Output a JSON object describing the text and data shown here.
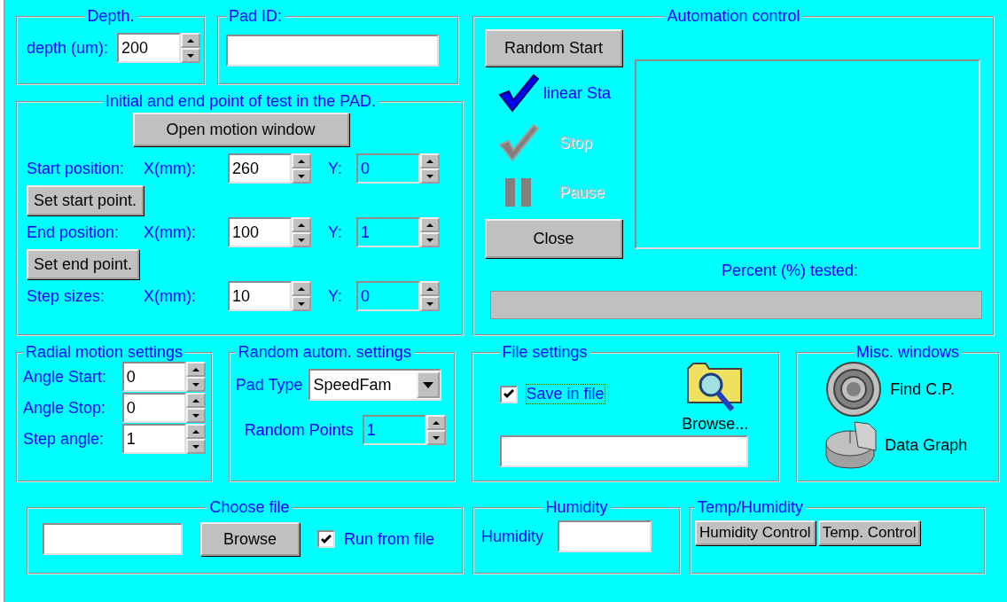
{
  "depth_group": {
    "title": "Depth.",
    "label": "depth (um):",
    "field": {
      "value": "200",
      "disabled": false
    }
  },
  "pad_id_group": {
    "title": "Pad ID:"
  },
  "test_points_group": {
    "title": "Initial and end point of test in the PAD.",
    "open_button": "Open motion window",
    "rows": [
      {
        "label": "Start position:",
        "x_label": "X(mm):",
        "x": {
          "value": "260",
          "disabled": false
        },
        "y_label": "Y:",
        "y": {
          "value": "0",
          "disabled": true
        },
        "button": "Set start point."
      },
      {
        "label": "End position:",
        "x_label": "X(mm):",
        "x": {
          "value": "100",
          "disabled": false
        },
        "y_label": "Y:",
        "y": {
          "value": "1",
          "disabled": true
        },
        "button": "Set end point."
      },
      {
        "label": "Step sizes:",
        "x_label": "X(mm):",
        "x": {
          "value": "10",
          "disabled": false
        },
        "y_label": "Y:",
        "y": {
          "value": "0",
          "disabled": true
        }
      }
    ]
  },
  "automation_group": {
    "title": "Automation control",
    "random_button": "Random Start",
    "options": [
      {
        "kind": "check",
        "label": "linear Sta",
        "disabled": false
      },
      {
        "kind": "check",
        "label": "Stop",
        "disabled": true
      },
      {
        "kind": "pause",
        "label": "Pause",
        "disabled": true
      }
    ],
    "close_button": "Close",
    "progress_label": "Percent (%)  tested:",
    "progress": {
      "level": 0
    }
  },
  "radial_group": {
    "title": "Radial motion settings",
    "rows": [
      {
        "label": "Angle Start:",
        "field": {
          "value": "0",
          "disabled": false
        }
      },
      {
        "label": "Angle Stop:",
        "field": {
          "value": "0",
          "disabled": false
        }
      },
      {
        "label": "Step angle:",
        "field": {
          "value": "1",
          "disabled": false
        }
      }
    ]
  },
  "random_group": {
    "title": "Random  autom. settings",
    "pad_type_label": "Pad Type",
    "pad_type": "SpeedFam",
    "points_label": "Random Points",
    "points": {
      "value": "1",
      "disabled": true
    }
  },
  "file_group": {
    "title": "File settings",
    "save_label": "Save in file",
    "save_checked": true,
    "browse_label": "Browse..."
  },
  "misc_group": {
    "title": "Misc. windows",
    "items": [
      {
        "kind": "target",
        "label": "Find C.P."
      },
      {
        "kind": "pie",
        "label": "Data Graph"
      }
    ]
  },
  "choose_file_group": {
    "title": "Choose file",
    "browse_button": "Browse",
    "run_label": "Run from file",
    "run_checked": true
  },
  "humidity_group": {
    "title": "Humidity",
    "label": "Humidity"
  },
  "temp_group": {
    "title": "Temp/Humidity",
    "buttons": [
      "Humidity Control",
      "Temp. Control"
    ]
  }
}
